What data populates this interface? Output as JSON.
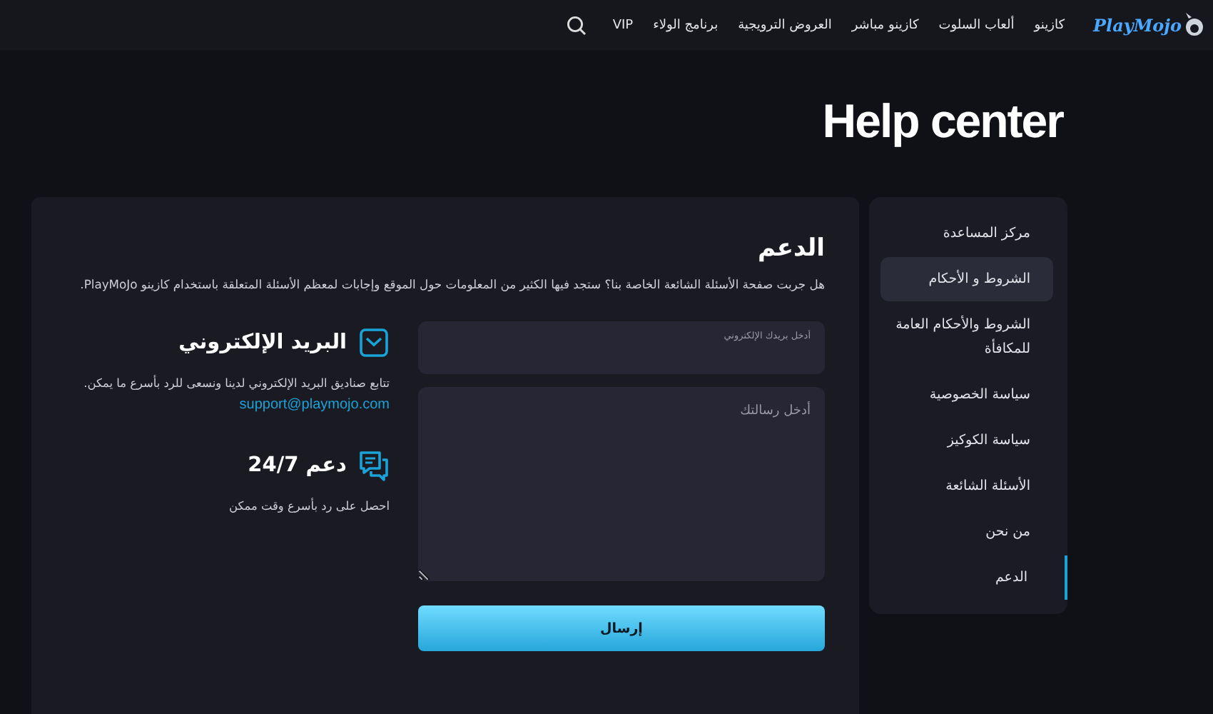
{
  "header": {
    "logo": "PlayMojo",
    "nav": [
      {
        "label": "كازينو"
      },
      {
        "label": "ألعاب السلوت"
      },
      {
        "label": "كازينو مباشر"
      },
      {
        "label": "العروض الترويجية"
      },
      {
        "label": "برنامج الولاء"
      },
      {
        "label": "VIP"
      }
    ]
  },
  "page_title": "Help center",
  "sidebar": {
    "items": [
      {
        "label": "مركز المساعدة",
        "selected": false,
        "hovered": false
      },
      {
        "label": "الشروط و الأحكام",
        "selected": false,
        "hovered": true
      },
      {
        "label": "الشروط والأحكام العامة للمكافأة",
        "selected": false,
        "hovered": false
      },
      {
        "label": "سياسة الخصوصية",
        "selected": false,
        "hovered": false
      },
      {
        "label": "سياسة الكوكيز",
        "selected": false,
        "hovered": false
      },
      {
        "label": "الأسئلة الشائعة",
        "selected": false,
        "hovered": false
      },
      {
        "label": "من نحن",
        "selected": false,
        "hovered": false
      },
      {
        "label": "الدعم",
        "selected": true,
        "hovered": false
      }
    ]
  },
  "support": {
    "title": "الدعم",
    "intro": "هل جربت صفحة الأسئلة الشائعة الخاصة بنا؟ ستجد فيها الكثير من المعلومات حول الموقع وإجابات لمعظم الأسئلة المتعلقة باستخدام كازينو PlayMoJo.",
    "form": {
      "email": {
        "placeholder": "أدخل بريدك الإلكتروني"
      },
      "message": {
        "placeholder": "أدخل رسالتك"
      },
      "submit": "إرسال"
    },
    "contacts": [
      {
        "kind": "email",
        "title": "البريد الإلكتروني",
        "text": "تتابع صناديق البريد الإلكتروني لدينا ونسعى للرد بأسرع ما يمكن.",
        "link": "support@playmojo.com"
      },
      {
        "kind": "chat",
        "title": "دعم 24/7",
        "text": "احصل على رد بأسرع وقت ممكن"
      }
    ]
  }
}
